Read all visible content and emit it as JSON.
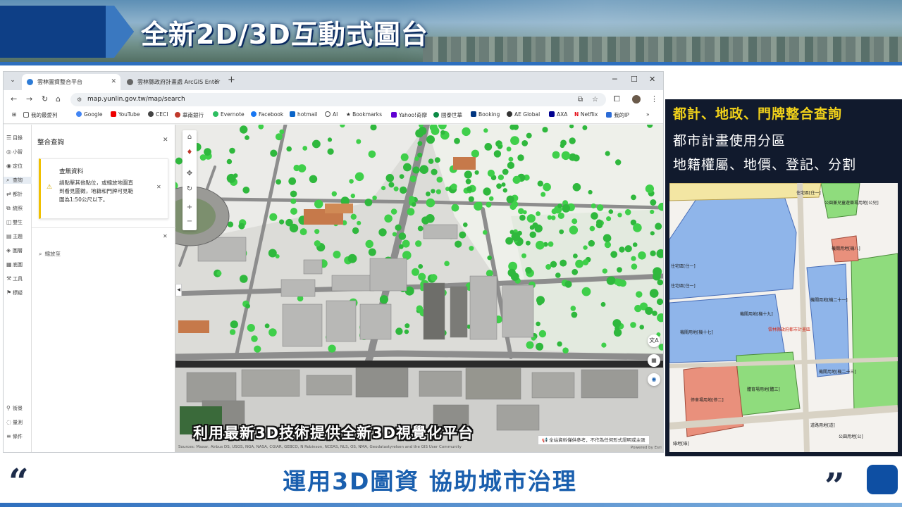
{
  "slide": {
    "title": "全新2D/3D互動式圖台",
    "caption": "利用最新3D技術提供全新3D視覺化平台",
    "bottom_slogan": "運用3D圖資  協助城市治理",
    "quote_open": "“",
    "quote_close": "”"
  },
  "browser": {
    "tabs": [
      {
        "label": "雲林圖資整合平台",
        "active": true
      },
      {
        "label": "雲林縣政府計畫處 ArcGIS Enter",
        "active": false
      }
    ],
    "url": "map.yunlin.gov.tw/map/search",
    "bookmarks": [
      "我的最愛列",
      "Google",
      "YouTube",
      "CECI",
      "華南銀行",
      "Evernote",
      "Facebook",
      "hotmail",
      "AI",
      "Bookmarks",
      "Yahoo!奇摩",
      "國泰世華",
      "Booking",
      "AE Global",
      "AXA",
      "Netflix",
      "我的IP"
    ]
  },
  "app": {
    "rail_items": [
      "目錄",
      "小智",
      "定位",
      "查詢",
      "都計",
      "統照",
      "雙生",
      "主題",
      "圖層",
      "底圖",
      "工具",
      "標疑",
      "街景",
      "量測",
      "條件"
    ],
    "panel_title": "整合查詢",
    "notice_title": "查無資料",
    "notice_body": "請點擊其他點位，或縮放地圖直到看見圖徵，地籍和門牌可見範圍為1:50公尺以下。",
    "zoom_hint": "縮放至",
    "attribution": "Sources: Maxar, Airbus DS, USGS, NGA, NASA, CGIAR, GEBCO, N Robinson, NCEAS, NLS, OS, NMA, Geodatastyrelsen and the GIS User Community",
    "disclaimer": "全站資料僅供參考，不作為任何形式證明或主張",
    "powered_by": "Powered by Esri"
  },
  "right_panel": {
    "heading": "都計、地政、門牌整合查詢",
    "line1": "都市計畫使用分區",
    "line2": "地籍權屬、地價、登記、分割"
  },
  "zoning_map_labels": [
    "住宅區[住一]",
    "公園兼兒童遊樂場用地[公兒]",
    "機關用地[機八]",
    "住宅區[住一]",
    "住宅區[住一]",
    "機關用地[機十九]",
    "機關用地[機十七]",
    "機關用地[機二十一]",
    "停車場用地[停二]",
    "體育場用地[體三]",
    "機關用地[機二十三]",
    "道路用地[道]",
    "公園用地[公]",
    "綠地[綠]",
    "雲林縣政府都市計畫區"
  ],
  "colors": {
    "title_blue": "#0e3f86",
    "slogan_blue": "#1a5fae",
    "heading_yellow": "#f2d21a",
    "right_panel_bg": "#111a2d",
    "zone_institution": "#8fb5ea",
    "zone_park": "#8fdc7d",
    "zone_parking": "#e9907c",
    "zone_residential": "#f3e6a3"
  }
}
